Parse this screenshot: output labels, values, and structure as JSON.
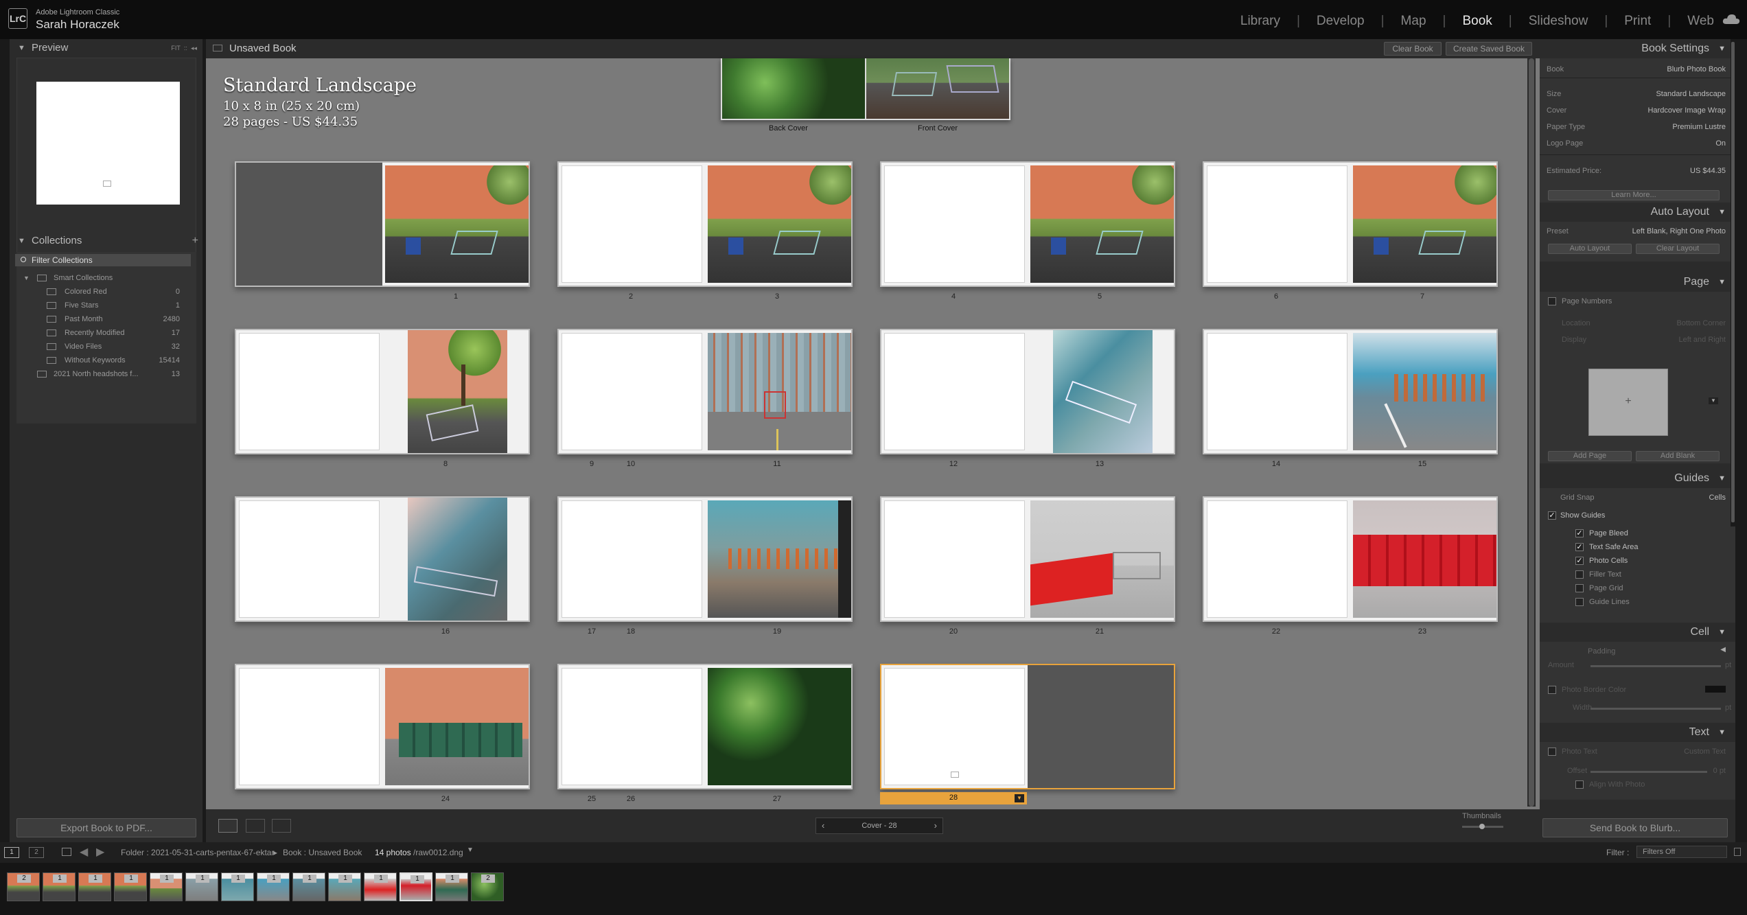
{
  "app": {
    "name": "Adobe Lightroom Classic",
    "user": "Sarah Horaczek",
    "logo": "LrC"
  },
  "modules": [
    "Library",
    "Develop",
    "Map",
    "Book",
    "Slideshow",
    "Print",
    "Web"
  ],
  "active_module": "Book",
  "left_panel": {
    "preview": {
      "title": "Preview",
      "zoom_labels": [
        "FIT",
        "::",
        "◂◂"
      ]
    },
    "collections": {
      "title": "Collections",
      "filter_label": "Filter Collections",
      "items": [
        {
          "label": "Smart Collections",
          "count": ""
        },
        {
          "label": "Colored Red",
          "count": "0"
        },
        {
          "label": "Five Stars",
          "count": "1"
        },
        {
          "label": "Past Month",
          "count": "2480"
        },
        {
          "label": "Recently Modified",
          "count": "17"
        },
        {
          "label": "Video Files",
          "count": "32"
        },
        {
          "label": "Without Keywords",
          "count": "15414"
        },
        {
          "label": "2021 North headshots f...",
          "count": "13"
        }
      ]
    },
    "export_button": "Export Book to PDF..."
  },
  "center": {
    "header_title": "Unsaved Book",
    "clear_book": "Clear Book",
    "create_saved_book": "Create Saved Book",
    "book_info": {
      "title": "Standard Landscape",
      "size": "10 x 8 in (25 x 20 cm)",
      "pages": "28 pages - US $44.35"
    },
    "cover_labels": {
      "back": "Back Cover",
      "front": "Front Cover"
    },
    "page_numbers": [
      "1",
      "2",
      "3",
      "4",
      "5",
      "6",
      "7",
      "8",
      "9",
      "10",
      "11",
      "12",
      "13",
      "14",
      "15",
      "16",
      "17",
      "18",
      "19",
      "20",
      "21",
      "22",
      "23",
      "24",
      "25",
      "26",
      "27",
      "28"
    ],
    "nav_label": "Cover - 28",
    "thumbnails_label": "Thumbnails"
  },
  "right_panel": {
    "book_settings": {
      "title": "Book Settings",
      "book": "Blurb Photo Book",
      "rows": [
        {
          "label": "Size",
          "value": "Standard Landscape"
        },
        {
          "label": "Cover",
          "value": "Hardcover Image Wrap"
        },
        {
          "label": "Paper Type",
          "value": "Premium Lustre"
        },
        {
          "label": "Logo Page",
          "value": "On"
        }
      ],
      "price_label": "Estimated Price:",
      "price": "US $44.35",
      "learn_more": "Learn More..."
    },
    "auto_layout": {
      "title": "Auto Layout",
      "preset_label": "Preset",
      "preset": "Left Blank, Right One Photo",
      "btn_auto": "Auto Layout",
      "btn_clear": "Clear Layout"
    },
    "page": {
      "title": "Page",
      "page_numbers": "Page Numbers",
      "location_label": "Location",
      "location": "Bottom Corner",
      "display_label": "Display",
      "display": "Left and Right",
      "add_page": "Add Page",
      "add_blank": "Add Blank"
    },
    "guides": {
      "title": "Guides",
      "grid_snap_label": "Grid Snap",
      "grid_snap": "Cells",
      "show_guides": "Show Guides",
      "options": [
        {
          "label": "Page Bleed",
          "checked": true
        },
        {
          "label": "Text Safe Area",
          "checked": true
        },
        {
          "label": "Photo Cells",
          "checked": true
        },
        {
          "label": "Filler Text",
          "checked": false
        },
        {
          "label": "Page Grid",
          "checked": false
        },
        {
          "label": "Guide Lines",
          "checked": false
        }
      ]
    },
    "cell": {
      "title": "Cell",
      "padding": "Padding",
      "amount": "Amount",
      "amount_unit": "pt",
      "border_color": "Photo Border Color",
      "width": "Width",
      "width_unit": "pt"
    },
    "text": {
      "title": "Text",
      "photo_text": "Photo Text",
      "custom_text": "Custom Text",
      "offset": "Offset",
      "offset_value": "0 pt",
      "align": "Align With Photo"
    },
    "send_button": "Send Book to Blurb..."
  },
  "filmstrip": {
    "screens": [
      "1",
      "2"
    ],
    "source": "Folder : 2021-05-31-carts-pentax-67-ektar",
    "book": "Book : Unsaved Book",
    "photos": "14 photos",
    "file": "/raw0012.dng",
    "filter_label": "Filter :",
    "filter_value": "Filters Off",
    "badges": [
      "2",
      "1",
      "1",
      "1",
      "1",
      "1",
      "1",
      "1",
      "1",
      "1",
      "1",
      "1",
      "1",
      "2"
    ]
  },
  "colors": {
    "accent_selected": "#e8a33c",
    "panel": "#2b2b2b",
    "workspace": "#7a7a7a"
  }
}
